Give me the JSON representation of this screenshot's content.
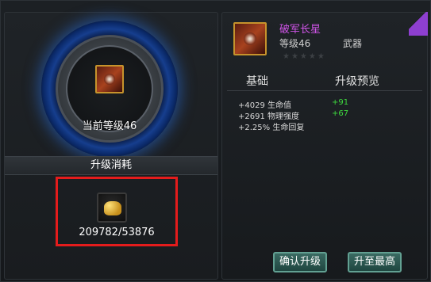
{
  "left": {
    "current_level": "当前等级46",
    "cost_title": "升级消耗",
    "cost_value": "209782/53876"
  },
  "item": {
    "name": "破军长星",
    "level": "等级46",
    "type": "武器",
    "stars": "★★★★★"
  },
  "columns": {
    "base": "基础",
    "preview": "升级预览"
  },
  "stats": [
    {
      "base": "+4029 生命值",
      "up": "+91"
    },
    {
      "base": "+2691 物理强度",
      "up": "+67"
    },
    {
      "base": "+2.25% 生命回复",
      "up": ""
    }
  ],
  "buttons": {
    "confirm": "确认升级",
    "max": "升至最高"
  },
  "colors": {
    "item_name": "#d054e8",
    "upgrade_green": "#3ed83e",
    "highlight_box": "#e41c1c"
  }
}
